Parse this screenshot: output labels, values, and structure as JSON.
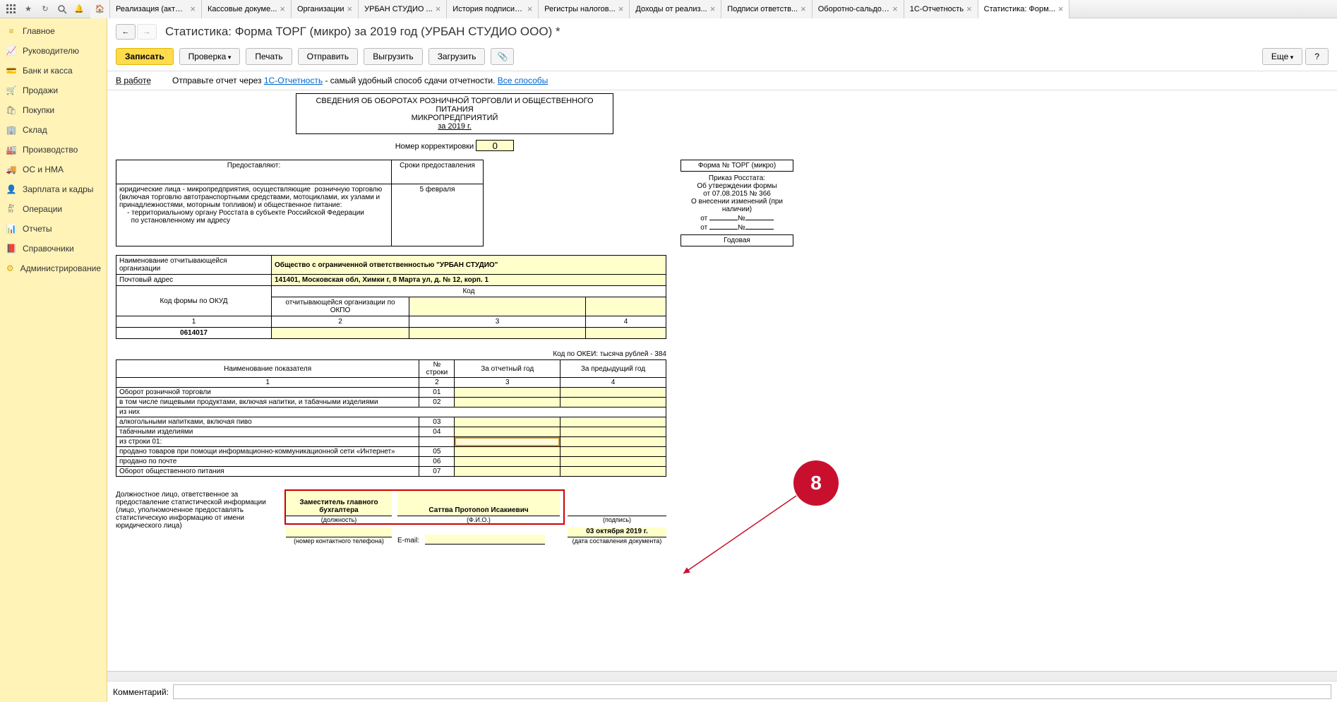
{
  "topbar_icons": [
    "apps",
    "star",
    "history",
    "search",
    "bell"
  ],
  "tabs": [
    {
      "label": "Реализация (акты,..."
    },
    {
      "label": "Кассовые докуме..."
    },
    {
      "label": "Организации"
    },
    {
      "label": "УРБАН СТУДИО ..."
    },
    {
      "label": "История подписи: ..."
    },
    {
      "label": "Регистры налогов..."
    },
    {
      "label": "Доходы от реализ..."
    },
    {
      "label": "Подписи ответств..."
    },
    {
      "label": "Оборотно-сальдов..."
    },
    {
      "label": "1С-Отчетность"
    },
    {
      "label": "Статистика: Форм...",
      "active": true
    }
  ],
  "sidebar": [
    {
      "label": "Главное",
      "icon": "≡"
    },
    {
      "label": "Руководителю",
      "icon": "📈"
    },
    {
      "label": "Банк и касса",
      "icon": "💳"
    },
    {
      "label": "Продажи",
      "icon": "🛒"
    },
    {
      "label": "Покупки",
      "icon": "🛍"
    },
    {
      "label": "Склад",
      "icon": "🏢"
    },
    {
      "label": "Производство",
      "icon": "🏭"
    },
    {
      "label": "ОС и НМА",
      "icon": "🚚"
    },
    {
      "label": "Зарплата и кадры",
      "icon": "👤"
    },
    {
      "label": "Операции",
      "icon": "Дт Кт"
    },
    {
      "label": "Отчеты",
      "icon": "📊"
    },
    {
      "label": "Справочники",
      "icon": "📕"
    },
    {
      "label": "Администрирование",
      "icon": "⚙"
    }
  ],
  "page_title": "Статистика: Форма ТОРГ (микро) за 2019 год (УРБАН СТУДИО ООО) *",
  "toolbar": {
    "write": "Записать",
    "check": "Проверка",
    "print": "Печать",
    "send": "Отправить",
    "upload": "Выгрузить",
    "download": "Загрузить",
    "more": "Еще",
    "help": "?"
  },
  "status": {
    "label": "В работе",
    "text1": "Отправьте отчет через ",
    "link1": "1С-Отчетность",
    "text2": " - самый удобный способ сдачи отчетности. ",
    "link2": "Все способы"
  },
  "title_box": {
    "l1": "СВЕДЕНИЯ ОБ ОБОРОТАХ РОЗНИЧНОЙ ТОРГОВЛИ И ОБЩЕСТВЕННОГО ПИТАНИЯ",
    "l2": "МИКРОПРЕДПРИЯТИЙ",
    "l3": "за 2019 г."
  },
  "corr": {
    "label": "Номер корректировки",
    "value": "0"
  },
  "left_table": {
    "h1": "Предоставляют:",
    "h2": "Сроки предоставления",
    "desc": "юридические лица - микропредприятия, осуществляющие  розничную торговлю (включая торговлю автотранспортными средствами, мотоциклами, их узлами и принадлежностями, моторным топливом) и общественное питание:\n    - территориальному органу Росстата в субъекте Российской Федерации\n      по установленному им адресу",
    "srok": "5 февраля"
  },
  "right_box": {
    "form": "Форма № ТОРГ (микро)",
    "l1": "Приказ Росстата:",
    "l2": "Об утверждении формы",
    "l3": "от 07.08.2015 № 366",
    "l4": "О внесении изменений (при наличии)",
    "l5": "от ___________№___________",
    "l6": "от ___________№___________",
    "ann": "Годовая"
  },
  "org": {
    "name_label": "Наименование отчитывающейся организации",
    "name": "Общество с ограниченной ответственностью \"УРБАН СТУДИО\"",
    "addr_label": "Почтовый адрес",
    "addr": "141401, Московская обл, Химки г, 8 Марта ул, д. № 12, корп. 1",
    "code_hdr": "Код",
    "okud_label": "Код формы по ОКУД",
    "okpo_label": "отчитывающейся организации по ОКПО",
    "r1": "1",
    "r2": "2",
    "r3": "3",
    "r4": "4",
    "okud": "0614017"
  },
  "okei": "Код по ОКЕИ: тысяча рублей - 384",
  "data_tbl": {
    "h1": "Наименование показателя",
    "h2": "№ строки",
    "h3": "За отчетный год",
    "h4": "За предыдущий год",
    "rows": [
      {
        "name": "Оборот розничной торговли",
        "num": "01"
      },
      {
        "name": "   в том числе пищевыми продуктами, включая напитки, и табачными изделиями",
        "num": "02"
      },
      {
        "name": "   из них",
        "num": ""
      },
      {
        "name": "      алкогольными напитками, включая пиво",
        "num": "03"
      },
      {
        "name": "      табачными изделиями",
        "num": "04"
      },
      {
        "name": "   из строки 01:",
        "num": ""
      },
      {
        "name": "      продано товаров при помощи информационно-коммуникационной сети «Интернет»",
        "num": "05"
      },
      {
        "name": "      продано по почте",
        "num": "06"
      },
      {
        "name": "Оборот общественного питания",
        "num": "07"
      }
    ]
  },
  "sign": {
    "left": "Должностное лицо, ответственное за предоставление статистической информации (лицо, уполномоченное предоставлять статистическую информацию от имени юридического лица)",
    "pos": "Заместитель главного бухгалтера",
    "pos_cap": "(должность)",
    "fio": "Саттва Протопоп Исакиевич",
    "fio_cap": "(Ф.И.О.)",
    "sig_cap": "(подпись)",
    "tel_cap": "(номер контактного телефона)",
    "email_label": "E-mail:",
    "date": "03 октября 2019 г.",
    "date_cap": "(дата составления документа)"
  },
  "callout": "8",
  "comment_label": "Комментарий:"
}
